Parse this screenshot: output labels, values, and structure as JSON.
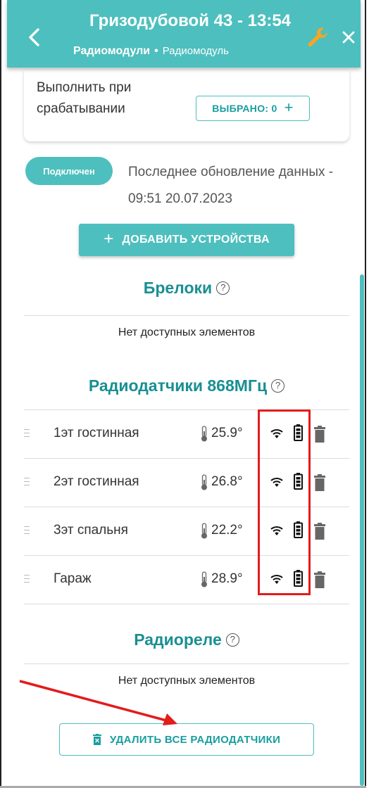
{
  "header": {
    "title": "Гризодубовой 43 - 13:54",
    "breadcrumb_parent": "Радиомодули",
    "breadcrumb_separator": "•",
    "breadcrumb_current": "Радиомодуль",
    "bg_color": "#4dbfbe"
  },
  "exec_card": {
    "label": "Выполнить при срабатывании",
    "selected_label": "ВЫБРАНО: 0",
    "add_symbol": "+"
  },
  "status": {
    "badge": "Подключен",
    "last_update": "Последнее обновление данных - 09:51 20.07.2023"
  },
  "add_devices_button": {
    "symbol": "+",
    "label": "ДОБАВИТЬ УСТРОЙСТВА"
  },
  "sections": {
    "fobs": {
      "title": "Брелоки",
      "help": "?",
      "empty_text": "Нет доступных элементов"
    },
    "sensors": {
      "title": "Радиодатчики 868МГц",
      "help": "?",
      "items": [
        {
          "name": "1эт гостинная",
          "temperature": "25.9°"
        },
        {
          "name": "2эт гостинная",
          "temperature": "26.8°"
        },
        {
          "name": "3эт спальня",
          "temperature": "22.2°"
        },
        {
          "name": "Гараж",
          "temperature": "28.9°"
        }
      ]
    },
    "relays": {
      "title": "Радиореле",
      "help": "?",
      "empty_text": "Нет доступных элементов"
    }
  },
  "delete_all_button": {
    "label": "УДАЛИТЬ ВСЕ РАДИОДАТЧИКИ"
  },
  "icons": [
    "back-icon",
    "wrench-icon",
    "close-icon",
    "help-icon",
    "drag-handle-icon",
    "thermometer-icon",
    "wifi-icon",
    "battery-icon",
    "trash-icon"
  ],
  "annotation_color": "#e31b1b"
}
